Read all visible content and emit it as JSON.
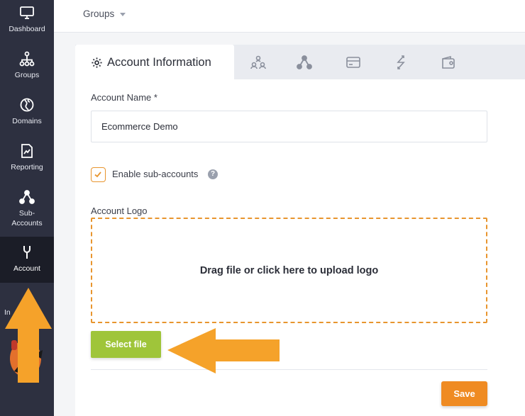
{
  "sidebar": {
    "items": [
      {
        "label": "Dashboard",
        "icon": "monitor-icon"
      },
      {
        "label": "Groups",
        "icon": "hierarchy-icon"
      },
      {
        "label": "Domains",
        "icon": "globe-icon"
      },
      {
        "label": "Reporting",
        "icon": "report-icon"
      },
      {
        "label": "Sub-\nAccounts",
        "icon": "sub-accounts-icon"
      },
      {
        "label": "Account",
        "icon": "wrench-icon",
        "active": true
      }
    ],
    "partial_label": "In"
  },
  "topbar": {
    "groups_label": "Groups"
  },
  "tabs": {
    "active_label": "Account Information",
    "icons": [
      "users-icon",
      "share-nodes-icon",
      "credit-card-icon",
      "sync-arrows-icon",
      "wallet-icon"
    ]
  },
  "form": {
    "account_name_label": "Account Name *",
    "account_name_value": "Ecommerce Demo",
    "enable_sub_accounts_label": "Enable sub-accounts",
    "enable_sub_accounts_checked": true,
    "help_glyph": "?",
    "account_logo_label": "Account Logo",
    "dropzone_text": "Drag file or click here to upload logo",
    "select_file_label": "Select file",
    "save_label": "Save"
  },
  "colors": {
    "sidebar_bg": "#2d3040",
    "sidebar_active": "#1b1d27",
    "accent_orange": "#ef8b22",
    "dropzone_border": "#e8952e",
    "select_green": "#9fc53a",
    "annotation_arrow": "#f5a22a"
  }
}
